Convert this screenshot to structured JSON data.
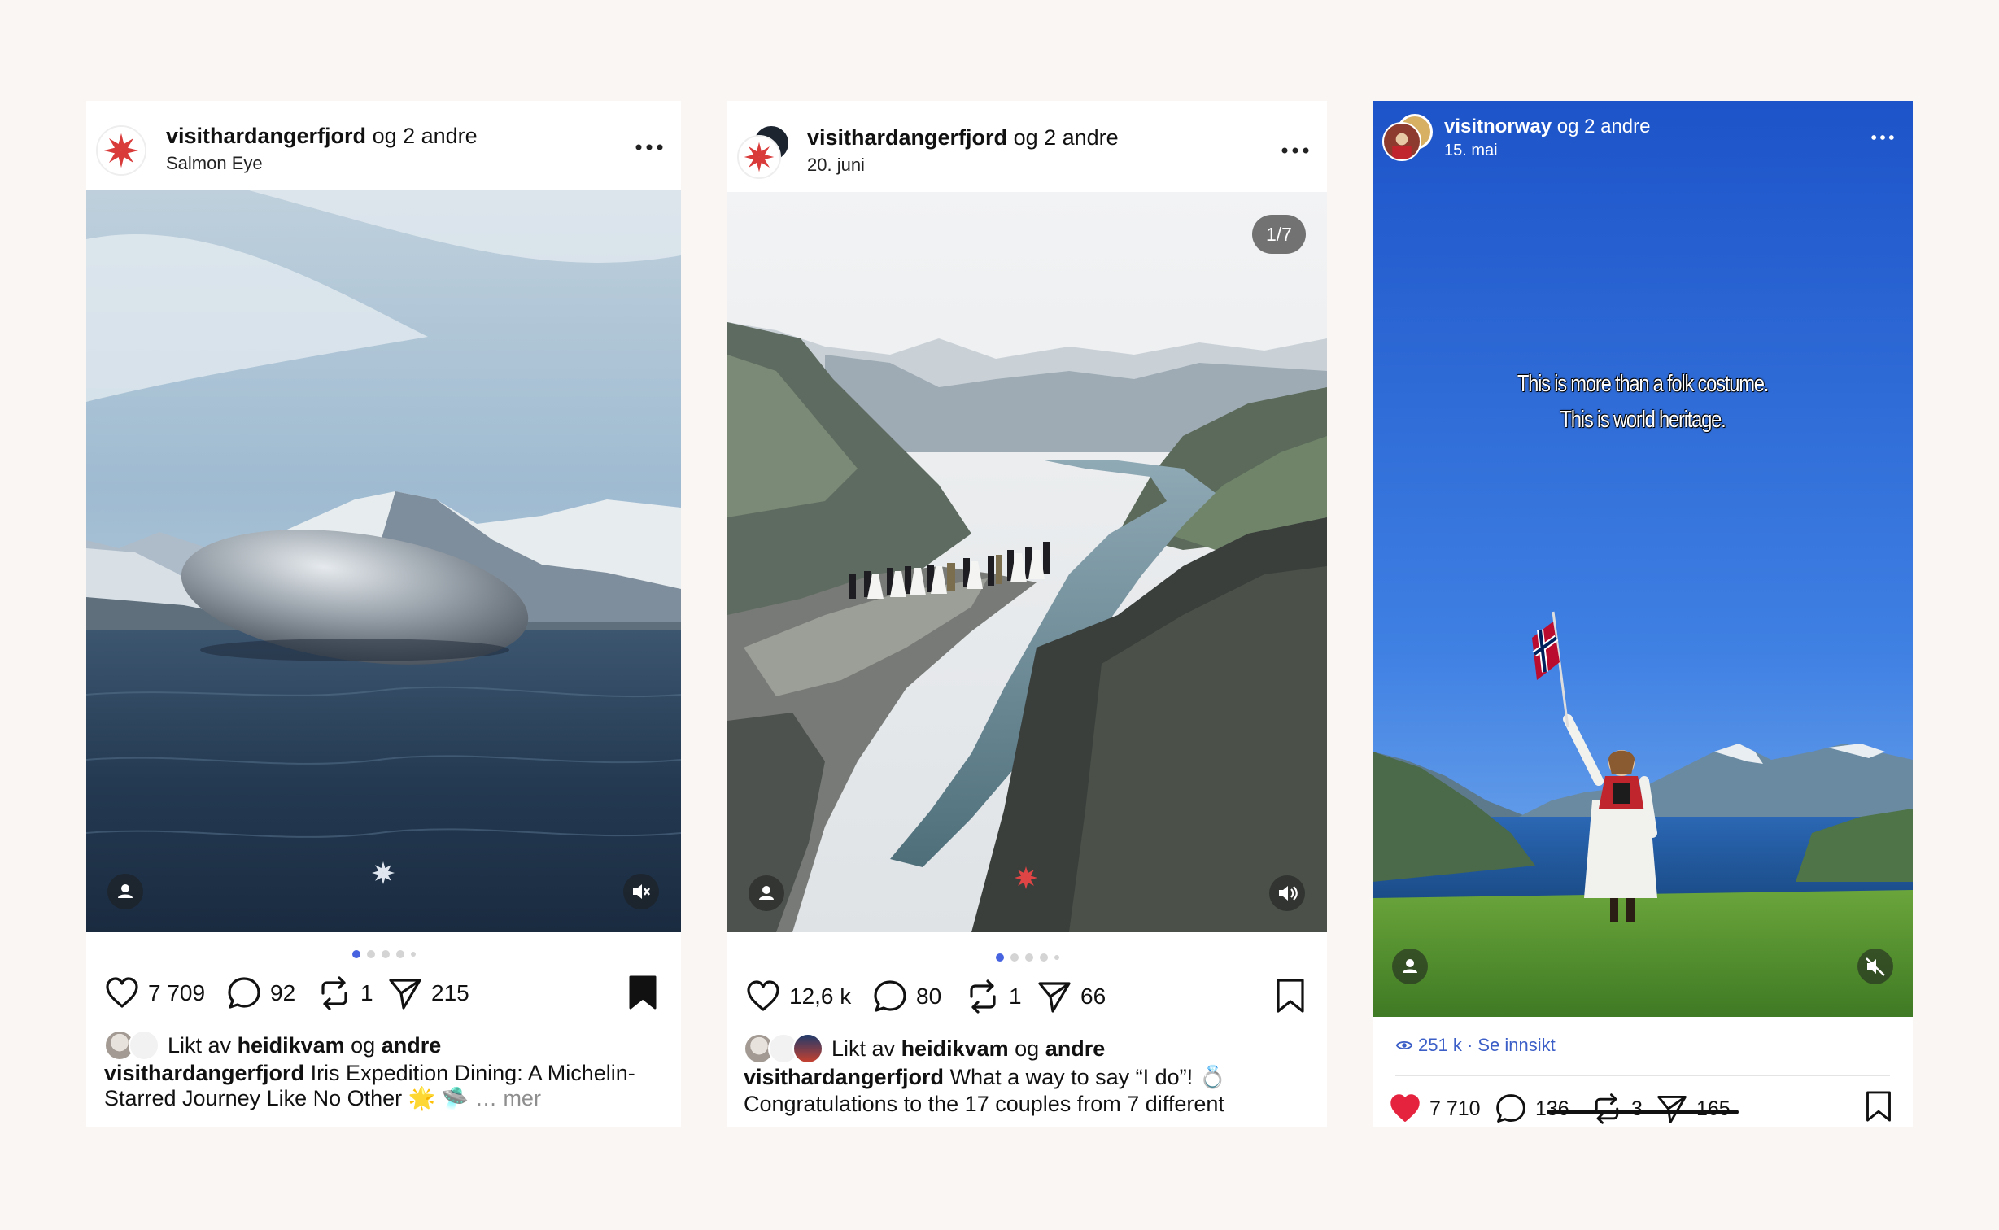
{
  "posts": [
    {
      "account": "visithardangerfjord",
      "collab_text": "og 2 andre",
      "subtitle": "Salmon Eye",
      "likes": "7 709",
      "comments": "92",
      "reposts": "1",
      "shares": "215",
      "liked_by_prefix": "Likt av",
      "liked_by_user": "heidikvam",
      "liked_by_and": "og",
      "liked_by_others": "andre",
      "caption_user": "visithardangerfjord",
      "caption_text": "Iris Expedition Dining: A Michelin-Starred Journey Like No Other 🌟 🛸",
      "caption_more": "… mer",
      "bookmarked": true
    },
    {
      "account": "visithardangerfjord",
      "collab_text": "og 2 andre",
      "subtitle": "20. juni",
      "counter": "1/7",
      "likes": "12,6 k",
      "comments": "80",
      "reposts": "1",
      "shares": "66",
      "liked_by_prefix": "Likt av",
      "liked_by_user": "heidikvam",
      "liked_by_and": "og",
      "liked_by_others": "andre",
      "caption_user": "visithardangerfjord",
      "caption_text": "What a way to say “I do”! 💍 Congratulations to the 17 couples from 7 different",
      "bookmarked": false
    },
    {
      "account": "visitnorway",
      "collab_text": "og 2 andre",
      "subtitle": "15. mai",
      "overlay_line1": "This is more than a folk costume.",
      "overlay_line2": "This is world heritage.",
      "views": "251 k",
      "insight_link": "· Se innsikt",
      "likes": "7 710",
      "comments": "136",
      "reposts": "3",
      "shares": "165",
      "liked": true,
      "bookmarked": false
    }
  ],
  "colors": {
    "background": "#f9f6f4",
    "accent_blue": "#4763e0",
    "like_red": "#e5233e",
    "insight_blue": "#3b5ec7"
  },
  "icons": [
    "more-icon",
    "user-tag-icon",
    "mute-icon",
    "sound-icon",
    "heart-icon",
    "comment-icon",
    "repost-icon",
    "share-icon",
    "bookmark-icon",
    "eye-icon",
    "star-logo-icon"
  ]
}
